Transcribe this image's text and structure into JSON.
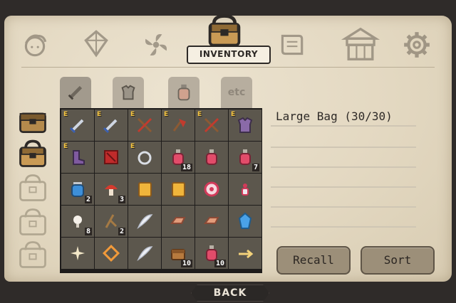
{
  "header": {
    "title": "INVENTORY"
  },
  "nav": [
    {
      "name": "character",
      "icon": "character-face-icon"
    },
    {
      "name": "skills",
      "icon": "crystal-icon"
    },
    {
      "name": "pinwheel",
      "icon": "pinwheel-icon"
    },
    {
      "name": "inventory",
      "icon": "bag-icon",
      "active": true
    },
    {
      "name": "quest",
      "icon": "scroll-icon"
    },
    {
      "name": "shop",
      "icon": "shop-icon"
    },
    {
      "name": "settings",
      "icon": "gear-icon"
    }
  ],
  "bags": [
    {
      "icon": "bag-icon",
      "state": "owned"
    },
    {
      "icon": "bag-icon",
      "state": "selected"
    },
    {
      "icon": "bag-icon",
      "state": "locked"
    },
    {
      "icon": "bag-icon",
      "state": "locked"
    },
    {
      "icon": "bag-icon",
      "state": "locked"
    }
  ],
  "tabs": [
    {
      "name": "weapons",
      "icon": "sword-icon"
    },
    {
      "name": "armor",
      "icon": "armor-icon"
    },
    {
      "name": "potions",
      "icon": "potion-icon"
    },
    {
      "name": "etc",
      "label": "etc"
    }
  ],
  "grid": {
    "cells": [
      {
        "icon": "sword-icon",
        "equipped": "E",
        "qty": ""
      },
      {
        "icon": "sword-icon",
        "equipped": "E",
        "qty": ""
      },
      {
        "icon": "crossbow-icon",
        "equipped": "E",
        "qty": ""
      },
      {
        "icon": "axe-icon",
        "equipped": "E",
        "qty": ""
      },
      {
        "icon": "crossbow-icon",
        "equipped": "E",
        "qty": ""
      },
      {
        "icon": "armor-icon",
        "equipped": "E",
        "qty": ""
      },
      {
        "icon": "boots-icon",
        "equipped": "E",
        "qty": ""
      },
      {
        "icon": "rune-icon",
        "equipped": "",
        "qty": ""
      },
      {
        "icon": "ring-icon",
        "equipped": "E",
        "qty": ""
      },
      {
        "icon": "potion-icon",
        "equipped": "",
        "qty": "18"
      },
      {
        "icon": "potion-icon",
        "equipped": "",
        "qty": ""
      },
      {
        "icon": "potion-icon",
        "equipped": "",
        "qty": "7"
      },
      {
        "icon": "jar-icon",
        "equipped": "",
        "qty": "2"
      },
      {
        "icon": "mushroom-icon",
        "equipped": "",
        "qty": "3"
      },
      {
        "icon": "book-icon",
        "equipped": "",
        "qty": ""
      },
      {
        "icon": "book-icon",
        "equipped": "",
        "qty": ""
      },
      {
        "icon": "target-icon",
        "equipped": "",
        "qty": ""
      },
      {
        "icon": "figure-icon",
        "equipped": "",
        "qty": ""
      },
      {
        "icon": "bulb-icon",
        "equipped": "",
        "qty": "8"
      },
      {
        "icon": "branch-icon",
        "equipped": "",
        "qty": "2"
      },
      {
        "icon": "feather-icon",
        "equipped": "",
        "qty": ""
      },
      {
        "icon": "ingot-icon",
        "equipped": "",
        "qty": ""
      },
      {
        "icon": "ingot-icon",
        "equipped": "",
        "qty": ""
      },
      {
        "icon": "gem-icon",
        "equipped": "",
        "qty": ""
      },
      {
        "icon": "sparkle-icon",
        "equipped": "",
        "qty": ""
      },
      {
        "icon": "scroll-icon",
        "equipped": "",
        "qty": ""
      },
      {
        "icon": "feather-icon",
        "equipped": "",
        "qty": ""
      },
      {
        "icon": "chest-icon",
        "equipped": "",
        "qty": "10"
      },
      {
        "icon": "potion-icon",
        "equipped": "",
        "qty": "10"
      },
      {
        "icon": "arrow-icon",
        "equipped": "",
        "qty": ""
      }
    ]
  },
  "panel": {
    "bag_label": "Large Bag (30/30)",
    "recall": "Recall",
    "sort": "Sort"
  },
  "footer": {
    "back": "BACK"
  }
}
